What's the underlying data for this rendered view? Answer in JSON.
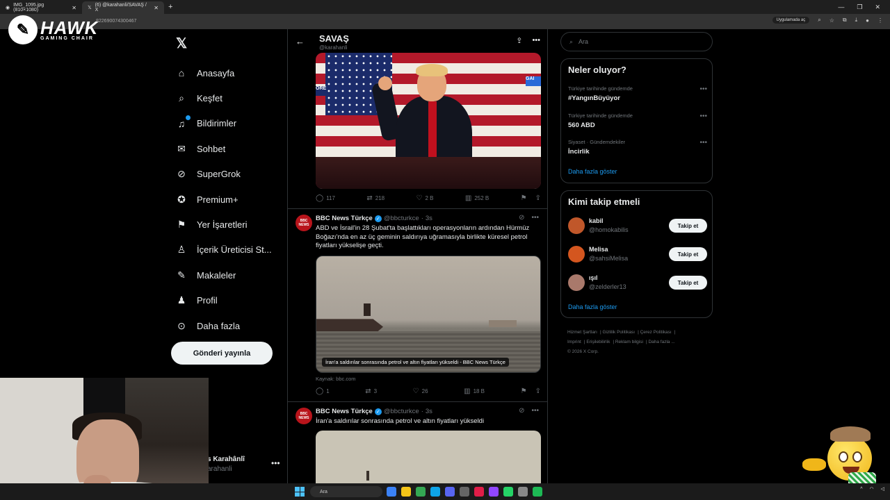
{
  "browser": {
    "tabs": [
      {
        "label": "IMG_1095.jpg (810×1080)"
      },
      {
        "label": "(6) @karahanli/SAVAŞ / X"
      }
    ],
    "url_fragment": "822690074300467",
    "app_pill": "Uygulamada aç"
  },
  "overlay": {
    "logo_text": "HAWK",
    "logo_sub": "GAMING CHAIR"
  },
  "nav": {
    "items": [
      {
        "label": "Anasayfa",
        "icon": "home-icon"
      },
      {
        "label": "Keşfet",
        "icon": "search-icon"
      },
      {
        "label": "Bildirimler",
        "icon": "bell-icon"
      },
      {
        "label": "Sohbet",
        "icon": "mail-icon"
      },
      {
        "label": "SuperGrok",
        "icon": "grok-icon"
      },
      {
        "label": "Premium+",
        "icon": "verified-icon"
      },
      {
        "label": "Yer İşaretleri",
        "icon": "bookmark-icon"
      },
      {
        "label": "İçerik Üreticisi St...",
        "icon": "creator-icon"
      },
      {
        "label": "Makaleler",
        "icon": "article-icon"
      },
      {
        "label": "Profil",
        "icon": "profile-icon"
      },
      {
        "label": "Daha fazla",
        "icon": "more-icon"
      }
    ],
    "post_button": "Gönderi yayınla",
    "account_name": "s Karahânlî",
    "account_handle": "arahanli"
  },
  "feed": {
    "title": "SAVAŞ",
    "handle": "@karahanli",
    "tweet0_actions": {
      "replies": "117",
      "reposts": "218",
      "likes": "2 B",
      "views": "252 B"
    },
    "tweet1": {
      "name": "BBC News Türkçe",
      "handle": "@bbcturkce",
      "time": "3s",
      "text": "ABD ve İsrail'in 28 Şubat'ta başlattıkları operasyonların ardından Hürmüz Boğazı'nda en az üç geminin saldırıya uğramasıyla birlikte küresel petrol fiyatları yükselişe geçti.",
      "card_caption": "İran'a saldırılar sonrasında petrol ve altın fiyatları yükseldi - BBC News Türkçe",
      "source": "Kaynak: bbc.com",
      "replies": "1",
      "reposts": "3",
      "likes": "26",
      "views": "18 B"
    },
    "tweet2": {
      "name": "BBC News Türkçe",
      "handle": "@bbcturkce",
      "time": "3s",
      "text": "İran'a saldırılar sonrasında petrol ve altın fiyatları yükseldi"
    },
    "avatar_label": "BBC NEWS"
  },
  "sidebar": {
    "search_placeholder": "Ara",
    "trends_title": "Neler oluyor?",
    "trends": [
      {
        "context": "Türkiye tarihinde gündemde",
        "name": "#YangınBüyüyor"
      },
      {
        "context": "Türkiye tarihinde gündemde",
        "name": "560 ABD"
      },
      {
        "context": "Siyaset · Gündemdekiler",
        "name": "İncirlik"
      }
    ],
    "trends_more": "Daha fazla göster",
    "follow_title": "Kimi takip etmeli",
    "follow": [
      {
        "name": "kabil",
        "handle": "@homokabilis",
        "color": "#c0572a"
      },
      {
        "name": "Melisa",
        "handle": "@sahsiMelisa",
        "color": "#d4561f"
      },
      {
        "name": "ışıl",
        "handle": "@zelderler13",
        "color": "#a9796b"
      }
    ],
    "follow_button": "Takip et",
    "follow_more": "Daha fazla göster",
    "footer": [
      "Hizmet Şartları",
      "Gizlilik Politikası",
      "Çerez Politikası",
      "Imprint",
      "Erişilebilirlik",
      "Reklam bilgisi",
      "Daha fazla ...",
      "© 2026 X Corp."
    ]
  },
  "taskbar": {
    "search_label": "Ara"
  },
  "colors": {
    "accent": "#1d9bf0",
    "background": "#000000",
    "border": "#2f3336",
    "muted": "#71767b"
  }
}
